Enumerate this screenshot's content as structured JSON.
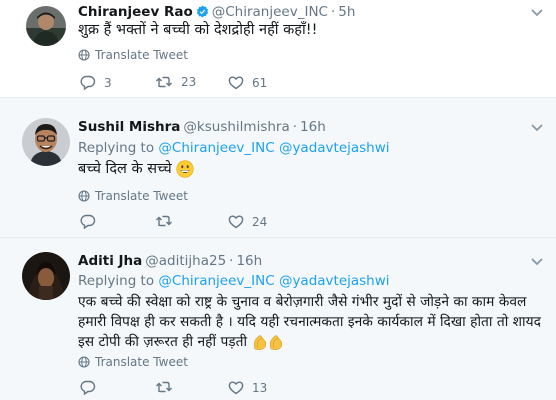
{
  "tweets": [
    {
      "name": "Chiranjeev Rao",
      "handle": "@Chiranjeev_INC",
      "time": "5h",
      "text": "शुक्र हैं भक्तों ने बच्ची को देशद्रोही नहीं कहाँ!!",
      "translate": "Translate Tweet",
      "replies": "3",
      "retweets": "23",
      "likes": "61"
    },
    {
      "name": "Sushil Mishra",
      "handle": "@ksushilmishra",
      "time": "16h",
      "replying_prefix": "Replying to",
      "replying_to_1": "@Chiranjeev_INC",
      "replying_to_2": "@yadavtejashwi",
      "text": "बच्चे दिल के सच्चे",
      "translate": "Translate Tweet",
      "replies": "",
      "retweets": "",
      "likes": "24"
    },
    {
      "name": "Aditi Jha",
      "handle": "@aditijha25",
      "time": "16h",
      "replying_prefix": "Replying to",
      "replying_to_1": "@Chiranjeev_INC",
      "replying_to_2": "@yadavtejashwi",
      "text_line1": "एक बच्चे की स्वेक्षा को राष्ट्र के चुनाव व बेरोज़गारी जैसे गंभीर मुदों से जोड़ने का काम केवल",
      "text_line2": "हमारी विपक्ष ही कर सकती है । यदि यही रचनात्मकता इनके कार्यकाल में दिखा होता तो शायद",
      "text_line3": "इस टोपी की ज़रूरत ही नहीं पड़ती",
      "translate": "Translate Tweet",
      "replies": "",
      "retweets": "",
      "likes": "13"
    }
  ],
  "icons": {
    "reply": "reply-icon",
    "retweet": "retweet-icon",
    "like": "heart-icon",
    "translate": "globe-icon",
    "more": "chevron-down-icon"
  },
  "colors": {
    "link": "#1da1f2",
    "muted": "#657786",
    "reply_bg": "#f5f8fa"
  }
}
